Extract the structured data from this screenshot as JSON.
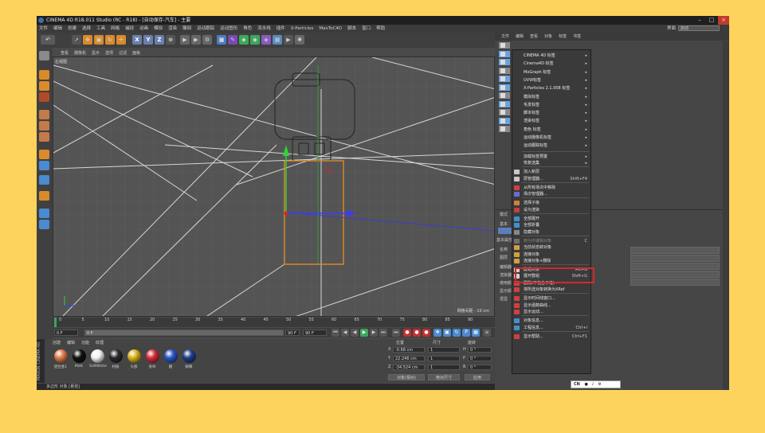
{
  "window": {
    "title": "CINEMA 4D R18.011 Studio (RC - R18) - [自动保存-汽车] - 主要"
  },
  "menubar": {
    "items": [
      "文件",
      "编辑",
      "创建",
      "选择",
      "工具",
      "网格",
      "捕捉",
      "动画",
      "模拟",
      "渲染",
      "雕刻",
      "运动跟踪",
      "运动图形",
      "角色",
      "流水线",
      "插件",
      "X-Particles",
      "MaxToC4D",
      "脚本",
      "窗口",
      "帮助"
    ],
    "layout_label": "界面",
    "layout_value": "启动"
  },
  "viewport": {
    "menu": [
      "查看",
      "摄像机",
      "显示",
      "选项",
      "过滤",
      "面板"
    ],
    "label": "右视图",
    "grid_spacing": "网格间距 : 10 cm"
  },
  "timeline": {
    "ticks": [
      "0",
      "5",
      "10",
      "15",
      "20",
      "25",
      "30",
      "35",
      "40",
      "45",
      "50",
      "55",
      "60",
      "65",
      "70",
      "75",
      "80",
      "85",
      "90"
    ],
    "current_frame": "0 F",
    "start_frame": "0 F",
    "end_frame": "90 F",
    "range_end": "90 F"
  },
  "materials": {
    "tabs": [
      "创建",
      "编辑",
      "功能",
      "纹理"
    ],
    "items": [
      {
        "label": "铝合金1",
        "color": "#e07a4a"
      },
      {
        "label": "Matt",
        "color": "#111111"
      },
      {
        "label": "SoftWhite",
        "color": "#f2f2f2"
      },
      {
        "label": "材质",
        "color": "#2a2a2a"
      },
      {
        "label": "头部",
        "color": "#d9b21c"
      },
      {
        "label": "身体",
        "color": "#d62b3a"
      },
      {
        "label": "腿",
        "color": "#2a56c8"
      },
      {
        "label": "眼睛",
        "color": "#1f3f8a"
      }
    ],
    "brand": "MAXON CINEMA 4D"
  },
  "coordinates": {
    "headers": [
      "位置",
      "尺寸",
      "旋转"
    ],
    "rows": [
      {
        "axis": "X",
        "pos": "-0.68 cm",
        "size": "1",
        "rot_axis": "H",
        "rot": "0 °"
      },
      {
        "axis": "Y",
        "pos": "22.246 cm",
        "size": "1",
        "rot_axis": "P",
        "rot": "0 °"
      },
      {
        "axis": "Z",
        "pos": "-34.524 cm",
        "size": "1",
        "rot_axis": "B",
        "rot": "0 °"
      }
    ],
    "mode": "对象(相对)",
    "size_mode": "绝对尺寸",
    "apply": "应用"
  },
  "status": {
    "text": "多边形 对象 [悬挂]"
  },
  "object_manager": {
    "menu": [
      "文件",
      "编辑",
      "查看",
      "对象",
      "标签",
      "书签"
    ],
    "row_count": 11
  },
  "attributes": {
    "labels": [
      "模式",
      "基本",
      "坐标",
      "对象",
      "基本属性",
      "名称",
      "图层",
      "编辑器可见",
      "渲染器可见",
      "使用颜色",
      "显示颜色",
      "透显"
    ]
  },
  "context_menu": {
    "items": [
      {
        "label": "CINEMA 4D 标签",
        "shortcut": "",
        "arrow": true,
        "color": ""
      },
      {
        "label": "Cinema4D 标签",
        "shortcut": "",
        "arrow": true,
        "color": ""
      },
      {
        "label": "MoGraph 标签",
        "shortcut": "",
        "arrow": true,
        "color": ""
      },
      {
        "label": "UVW标签",
        "shortcut": "",
        "arrow": true,
        "color": ""
      },
      {
        "label": "X-Particles 2.1.008 标签",
        "shortcut": "",
        "arrow": true,
        "color": ""
      },
      {
        "label": "模拟标签",
        "shortcut": "",
        "arrow": true,
        "color": ""
      },
      {
        "label": "毛发标签",
        "shortcut": "",
        "arrow": true,
        "color": ""
      },
      {
        "label": "脚本标签",
        "shortcut": "",
        "arrow": true,
        "color": ""
      },
      {
        "label": "渲染标签",
        "shortcut": "",
        "arrow": true,
        "color": ""
      },
      {
        "label": "角色 标签",
        "shortcut": "",
        "arrow": true,
        "color": ""
      },
      {
        "label": "运动摄像机标签",
        "shortcut": "",
        "arrow": true,
        "color": ""
      },
      {
        "label": "运动跟踪标签",
        "shortcut": "",
        "arrow": true,
        "color": ""
      },
      {
        "sep": true
      },
      {
        "label": "加载标签预置",
        "shortcut": "",
        "arrow": true,
        "color": ""
      },
      {
        "label": "恢复选集",
        "shortcut": "",
        "arrow": true,
        "color": ""
      },
      {
        "sep": true
      },
      {
        "label": "加入新层",
        "shortcut": "",
        "arrow": false,
        "color": "#c8c8c8"
      },
      {
        "label": "层管理器...",
        "shortcut": "Shift+F4",
        "arrow": false,
        "color": "#c8c8c8"
      },
      {
        "sep": true
      },
      {
        "label": "从所有场次中移除",
        "shortcut": "",
        "arrow": false,
        "color": "#d04040"
      },
      {
        "label": "场次管理器...",
        "shortcut": "",
        "arrow": false,
        "color": "#6b6bd0"
      },
      {
        "sep": true
      },
      {
        "label": "选择子级",
        "shortcut": "",
        "arrow": false,
        "color": "#d08040"
      },
      {
        "label": "设为渲染",
        "shortcut": "",
        "arrow": false,
        "color": "#c04040"
      },
      {
        "sep": true
      },
      {
        "label": "全部展开",
        "shortcut": "",
        "arrow": false,
        "color": "#4090d0"
      },
      {
        "label": "全部折叠",
        "shortcut": "",
        "arrow": false,
        "color": "#4090d0"
      },
      {
        "label": "隐藏对象",
        "shortcut": "",
        "arrow": false,
        "color": "#888888"
      },
      {
        "sep": true
      },
      {
        "label": "转为可编辑对象",
        "shortcut": "C",
        "arrow": false,
        "color": "#707070",
        "dim": true
      },
      {
        "label": "当前状态转对象",
        "shortcut": "",
        "arrow": false,
        "color": "#d0a040"
      },
      {
        "label": "连接对象",
        "shortcut": "",
        "arrow": false,
        "color": "#d0a040"
      },
      {
        "label": "连接对象+删除",
        "shortcut": "",
        "arrow": false,
        "color": "#d0a040"
      },
      {
        "sep": true
      },
      {
        "label": "群组对象",
        "shortcut": "Alt+G",
        "arrow": false,
        "color": "#d0d0d0"
      },
      {
        "label": "展开群组",
        "shortcut": "Shift+G",
        "arrow": false,
        "color": "#d0d0d0"
      },
      {
        "label": "删除(不包含子级)",
        "shortcut": "",
        "arrow": false,
        "color": "#d04040"
      },
      {
        "label": "将所选对象转换为XRef",
        "shortcut": "",
        "arrow": false,
        "color": "#d04040"
      },
      {
        "sep": true
      },
      {
        "label": "显示时间线窗口...",
        "shortcut": "",
        "arrow": false,
        "color": "#d04040"
      },
      {
        "label": "显示函数曲线...",
        "shortcut": "",
        "arrow": false,
        "color": "#d04040"
      },
      {
        "label": "显示运动...",
        "shortcut": "",
        "arrow": false,
        "color": "#d04040"
      },
      {
        "sep": true
      },
      {
        "label": "对象信息...",
        "shortcut": "",
        "arrow": false,
        "color": "#4090d0"
      },
      {
        "label": "工程信息...",
        "shortcut": "Ctrl+I",
        "arrow": false,
        "color": "#4090d0"
      },
      {
        "sep": true
      },
      {
        "label": "显示帮助...",
        "shortcut": "Ctrl+F1",
        "arrow": false,
        "color": "#d04040"
      }
    ]
  },
  "ime": {
    "text": "CN"
  }
}
